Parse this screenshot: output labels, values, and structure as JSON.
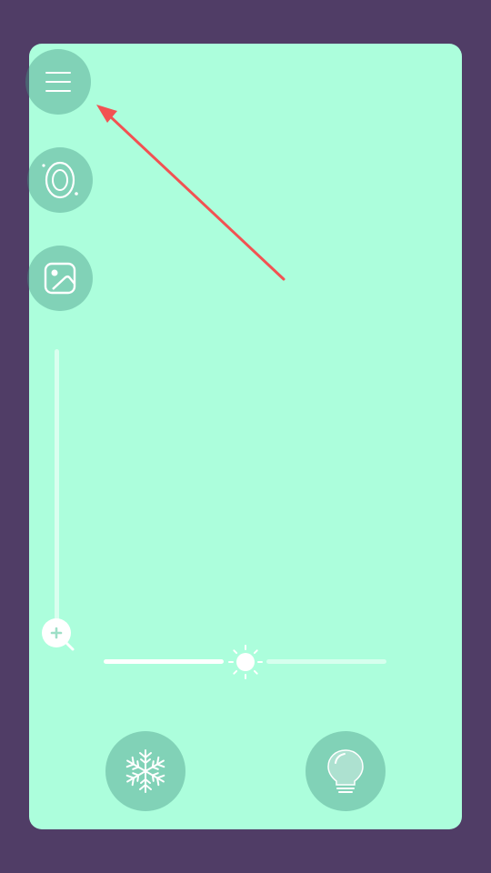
{
  "colors": {
    "background": "#503d66",
    "frame": "#acfedc",
    "button": "#46968280",
    "icon": "#ffffff",
    "annotation_arrow": "#f25252"
  },
  "controls": {
    "menu_icon": "menu-icon",
    "filter_icon": "lens-filter-icon",
    "gallery_icon": "gallery-icon",
    "zoom_icon": "zoom-in-icon",
    "brightness_icon": "sun-icon",
    "freeze_icon": "snowflake-icon",
    "light_icon": "lightbulb-icon"
  },
  "sliders": {
    "zoom_level": 0.0,
    "brightness_level": 0.5
  }
}
